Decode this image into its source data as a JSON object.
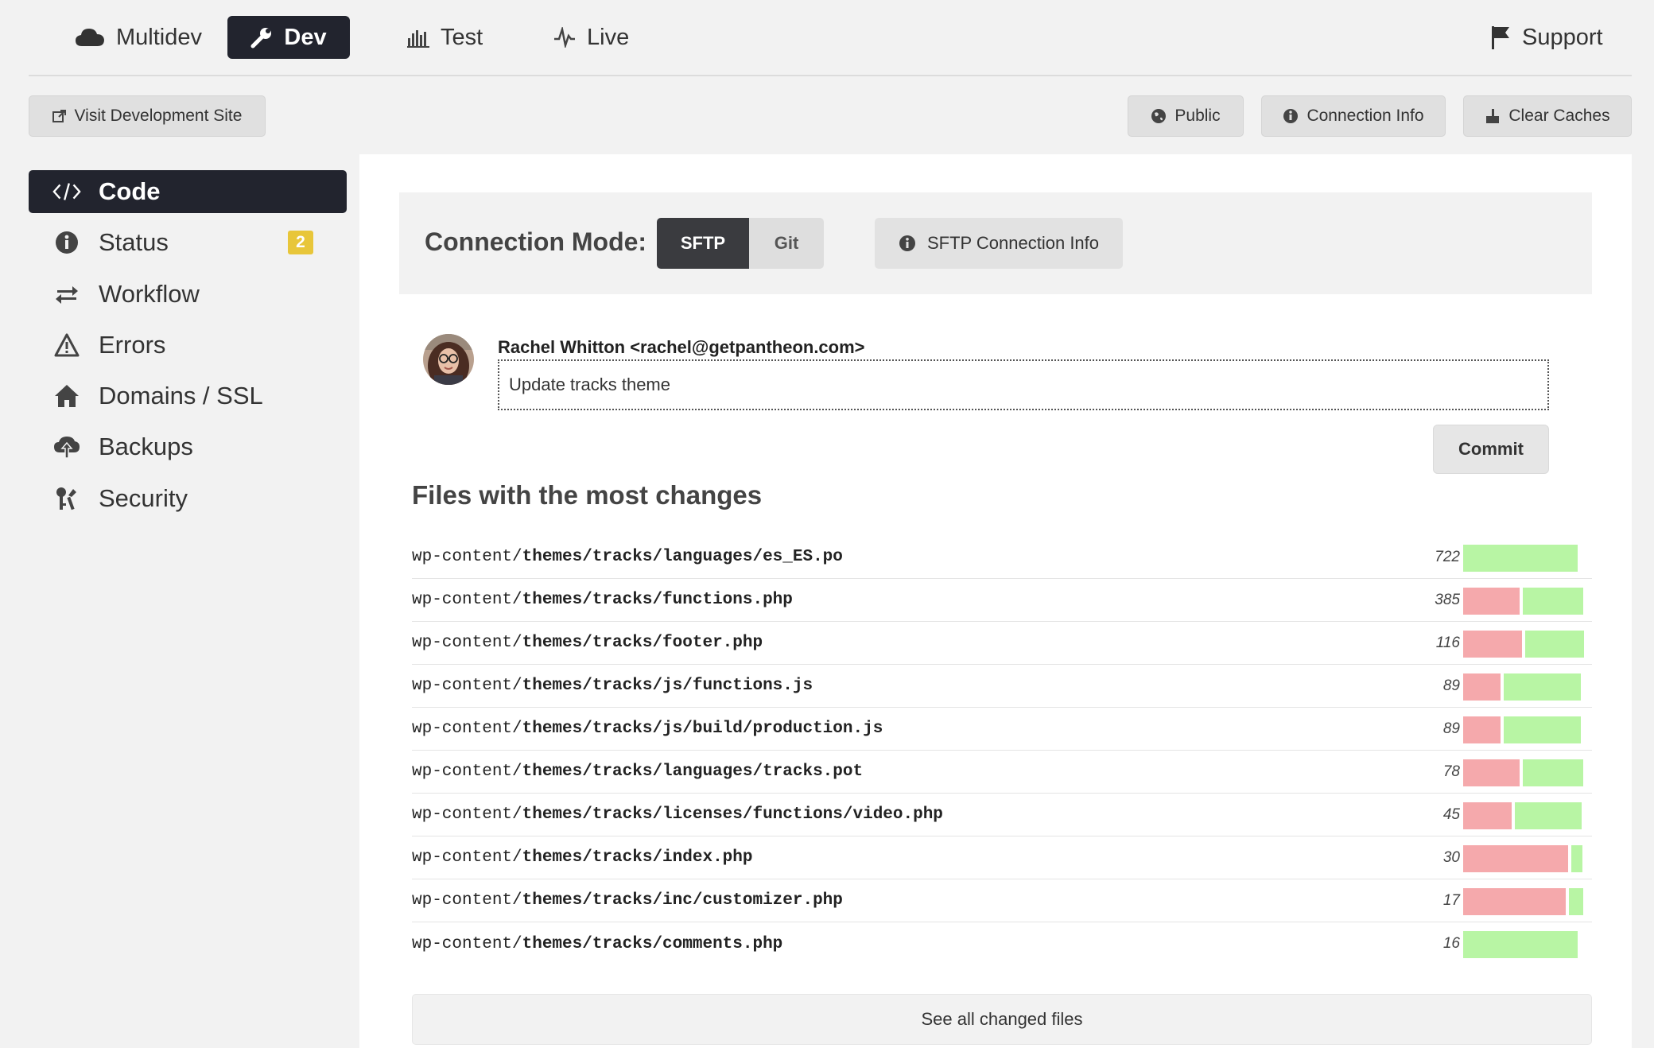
{
  "top_nav": {
    "tabs": [
      {
        "label": "Multidev",
        "icon": "cloud-icon"
      },
      {
        "label": "Dev",
        "icon": "wrench-icon",
        "active": true
      },
      {
        "label": "Test",
        "icon": "test-bars-icon"
      },
      {
        "label": "Live",
        "icon": "pulse-icon"
      }
    ],
    "support_label": "Support",
    "support_icon": "flag-icon"
  },
  "action_bar": {
    "visit_label": "Visit Development Site",
    "public_label": "Public",
    "connection_info_label": "Connection Info",
    "clear_caches_label": "Clear Caches"
  },
  "sidebar": {
    "items": [
      {
        "label": "Code",
        "icon": "code-icon",
        "active": true
      },
      {
        "label": "Status",
        "icon": "info-circle-icon",
        "badge": "2"
      },
      {
        "label": "Workflow",
        "icon": "exchange-arrows-icon"
      },
      {
        "label": "Errors",
        "icon": "warning-triangle-icon"
      },
      {
        "label": "Domains / SSL",
        "icon": "home-icon"
      },
      {
        "label": "Backups",
        "icon": "cloud-upload-icon"
      },
      {
        "label": "Security",
        "icon": "key-lock-icon"
      }
    ]
  },
  "connection": {
    "label": "Connection Mode:",
    "sftp_label": "SFTP",
    "git_label": "Git",
    "active_mode": "SFTP",
    "sftp_info_label": "SFTP Connection Info"
  },
  "commit": {
    "author": "Rachel Whitton <rachel@getpantheon.com>",
    "message": "Update tracks theme",
    "button_label": "Commit"
  },
  "files": {
    "title": "Files with the most changes",
    "see_all_label": "See all changed files",
    "colors": {
      "deletions": "#f5a9ac",
      "additions": "#b8f5a4"
    },
    "rows": [
      {
        "prefix": "wp-content/",
        "path": "themes/tracks/languages/es_ES.po",
        "count": "722",
        "deleted_fraction": 0.0,
        "added_fraction": 0.95
      },
      {
        "prefix": "wp-content/",
        "path": "themes/tracks/functions.php",
        "count": "385",
        "deleted_fraction": 0.47,
        "added_fraction": 0.5
      },
      {
        "prefix": "wp-content/",
        "path": "themes/tracks/footer.php",
        "count": "116",
        "deleted_fraction": 0.49,
        "added_fraction": 0.49
      },
      {
        "prefix": "wp-content/",
        "path": "themes/tracks/js/functions.js",
        "count": "89",
        "deleted_fraction": 0.31,
        "added_fraction": 0.64
      },
      {
        "prefix": "wp-content/",
        "path": "themes/tracks/js/build/production.js",
        "count": "89",
        "deleted_fraction": 0.31,
        "added_fraction": 0.64
      },
      {
        "prefix": "wp-content/",
        "path": "themes/tracks/languages/tracks.pot",
        "count": "78",
        "deleted_fraction": 0.47,
        "added_fraction": 0.5
      },
      {
        "prefix": "wp-content/",
        "path": "themes/tracks/licenses/functions/video.php",
        "count": "45",
        "deleted_fraction": 0.4,
        "added_fraction": 0.55
      },
      {
        "prefix": "wp-content/",
        "path": "themes/tracks/index.php",
        "count": "30",
        "deleted_fraction": 0.87,
        "added_fraction": 0.09
      },
      {
        "prefix": "wp-content/",
        "path": "themes/tracks/inc/customizer.php",
        "count": "17",
        "deleted_fraction": 0.85,
        "added_fraction": 0.12
      },
      {
        "prefix": "wp-content/",
        "path": "themes/tracks/comments.php",
        "count": "16",
        "deleted_fraction": 0.0,
        "added_fraction": 0.95
      }
    ]
  }
}
